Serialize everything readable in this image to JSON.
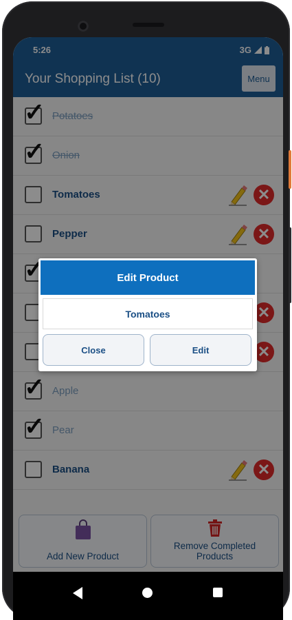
{
  "status": {
    "time": "5:26",
    "network": "3G"
  },
  "app": {
    "title": "Your Shopping List (10)",
    "menu_label": "Menu"
  },
  "items": [
    {
      "name": "Potatoes",
      "checked": true
    },
    {
      "name": "Onion",
      "checked": true
    },
    {
      "name": "Tomatoes",
      "checked": false
    },
    {
      "name": "Pepper",
      "checked": false
    },
    {
      "name": "",
      "checked": true
    },
    {
      "name": "",
      "checked": false
    },
    {
      "name": "",
      "checked": false
    },
    {
      "name": "Apple",
      "checked": true
    },
    {
      "name": "Pear",
      "checked": true
    },
    {
      "name": "Banana",
      "checked": false
    }
  ],
  "bottom": {
    "add_label": "Add New Product",
    "remove_label_line1": "Remove Completed",
    "remove_label_line2": "Products"
  },
  "dialog": {
    "title": "Edit Product",
    "value": "Tomatoes",
    "close_label": "Close",
    "edit_label": "Edit"
  },
  "icons": {
    "bag": "shopping-bag-icon",
    "trash": "trash-icon",
    "pencil": "pencil-icon",
    "delete": "delete-icon"
  },
  "colors": {
    "primary": "#1e5d96",
    "dialog_header": "#0e6fbe",
    "delete": "#e02b2b"
  }
}
